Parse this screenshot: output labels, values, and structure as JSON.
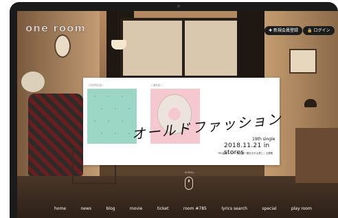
{
  "logo": {
    "text": "one room"
  },
  "header": {
    "register_label": "新規会員登録",
    "register_icon": "user-plus-icon",
    "login_label": "ログイン",
    "login_icon": "lock-icon"
  },
  "card": {
    "thumb1_label": "＜初回限定盤＞",
    "thumb2_label": "＜通常盤＞",
    "title": "オールドファッション",
    "single_label": "19th single",
    "release_date": "2018.11.21 in stores",
    "tie_in": "TBS金曜ドラマ「大恋愛～僕を忘れる君と」主題歌"
  },
  "scroll": {
    "label": "SCROLL"
  },
  "nav": {
    "items": [
      "home",
      "news",
      "blog",
      "movie",
      "ticket",
      "room #785",
      "lyrics search",
      "special",
      "play room"
    ]
  },
  "colors": {
    "thumb1": "#9cd6c4",
    "thumb2": "#f5c8cf",
    "header_button_bg": "#1c1c1c"
  }
}
